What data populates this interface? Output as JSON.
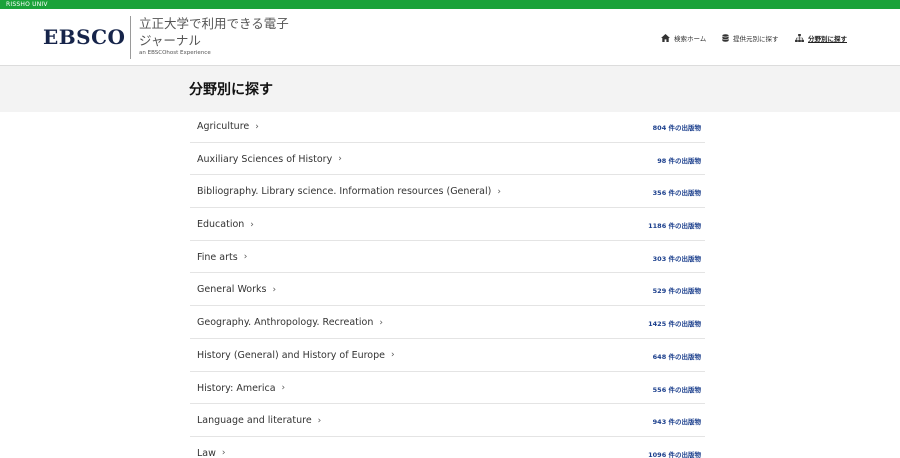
{
  "topbar": {
    "institution": "RISSHO UNIV"
  },
  "header": {
    "logo": "EBSCO",
    "title": "立正大学で利用できる電子ジャーナル",
    "subtitle": "an EBSCOhost Experience",
    "nav": [
      {
        "label": "検索ホーム",
        "icon": "home-icon"
      },
      {
        "label": "提供元別に探す",
        "icon": "database-icon"
      },
      {
        "label": "分野別に探す",
        "icon": "sitemap-icon"
      }
    ]
  },
  "page": {
    "title": "分野別に探す"
  },
  "subjects": [
    {
      "name": "Agriculture",
      "count": "804 件の出版物"
    },
    {
      "name": "Auxiliary Sciences of History",
      "count": "98 件の出版物"
    },
    {
      "name": "Bibliography. Library science. Information resources (General)",
      "count": "356 件の出版物"
    },
    {
      "name": "Education",
      "count": "1186 件の出版物"
    },
    {
      "name": "Fine arts",
      "count": "303 件の出版物"
    },
    {
      "name": "General Works",
      "count": "529 件の出版物"
    },
    {
      "name": "Geography. Anthropology. Recreation",
      "count": "1425 件の出版物"
    },
    {
      "name": "History (General) and History of Europe",
      "count": "648 件の出版物"
    },
    {
      "name": "History: America",
      "count": "556 件の出版物"
    },
    {
      "name": "Language and literature",
      "count": "943 件の出版物"
    },
    {
      "name": "Law",
      "count": "1096 件の出版物"
    }
  ],
  "colors": {
    "topbar": "#1ba23a",
    "logo": "#16244a",
    "count": "#1a3e8c"
  }
}
